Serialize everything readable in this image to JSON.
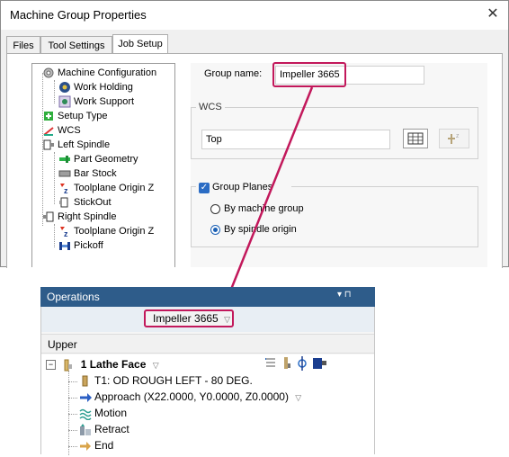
{
  "dialog": {
    "title": "Machine Group Properties",
    "close_glyph": "✕",
    "tabs": [
      {
        "label": "Files",
        "active": false
      },
      {
        "label": "Tool Settings",
        "active": false
      },
      {
        "label": "Job Setup",
        "active": true
      }
    ],
    "tree": [
      {
        "label": "Machine Configuration",
        "icon": "gear-icon"
      },
      {
        "label": "Work Holding",
        "icon": "chuck-icon"
      },
      {
        "label": "Work Support",
        "icon": "support-icon"
      },
      {
        "label": "Setup Type",
        "icon": "setup-type-icon"
      },
      {
        "label": "WCS",
        "icon": "wcs-icon"
      },
      {
        "label": "Left Spindle",
        "icon": "spindle-icon"
      },
      {
        "label": "Part Geometry",
        "icon": "part-icon"
      },
      {
        "label": "Bar Stock",
        "icon": "stock-icon"
      },
      {
        "label": "Toolplane Origin Z",
        "icon": "toolplane-icon"
      },
      {
        "label": "StickOut",
        "icon": "stickout-icon"
      },
      {
        "label": "Right Spindle",
        "icon": "spindle-icon"
      },
      {
        "label": "Toolplane Origin Z",
        "icon": "toolplane-icon"
      },
      {
        "label": "Pickoff",
        "icon": "pickoff-icon"
      }
    ],
    "group_name_label": "Group name:",
    "group_name_value": "Impeller 3665",
    "wcs": {
      "title": "WCS",
      "value": "Top"
    },
    "group_planes": {
      "title": "Group Planes",
      "checked": true,
      "options": [
        {
          "label": "By machine group",
          "selected": false
        },
        {
          "label": "By spindle origin",
          "selected": true
        }
      ]
    }
  },
  "operations": {
    "title": "Operations",
    "header_buttons": "▾  ⊓",
    "machine_group": "Impeller 3665",
    "dropdown_glyph": "▽",
    "upper_label": "Upper",
    "items": [
      {
        "label": "1 Lathe Face",
        "bold": true,
        "icon": "face-op-icon"
      },
      {
        "label": "T1: OD ROUGH LEFT - 80 DEG.",
        "icon": "tool-icon"
      },
      {
        "label": "Approach (X22.0000, Y0.0000, Z0.0000)",
        "icon": "approach-arrow-icon"
      },
      {
        "label": "Motion",
        "icon": "motion-icon"
      },
      {
        "label": "Retract",
        "icon": "retract-icon"
      },
      {
        "label": "End",
        "icon": "end-arrow-icon"
      }
    ]
  },
  "colors": {
    "accent": "#c2185b",
    "ops_header": "#2e5c8a"
  }
}
